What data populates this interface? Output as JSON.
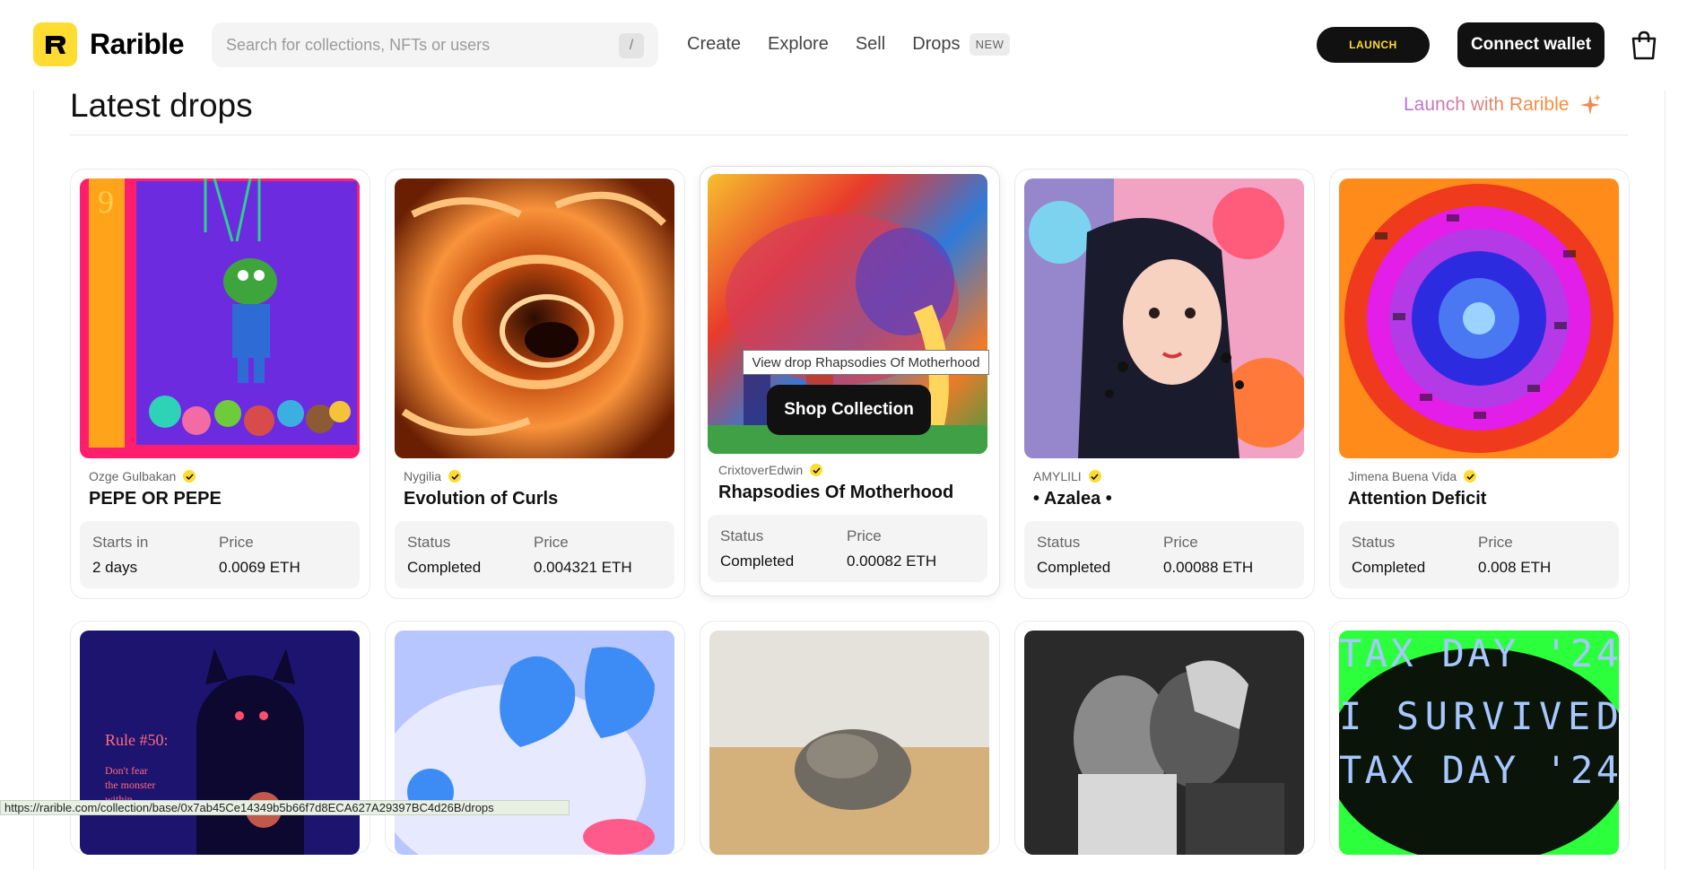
{
  "header": {
    "logo_text": "Rarible",
    "search_placeholder": "Search for collections, NFTs or users",
    "search_shortcut": "/",
    "nav": [
      "Create",
      "Explore",
      "Sell",
      "Drops"
    ],
    "drops_badge": "NEW",
    "launch_label": "LAUNCH",
    "connect_label": "Connect wallet"
  },
  "section": {
    "title": "Latest drops",
    "launch_with_prefix": "Launch with",
    "launch_with_brand": "Rarible"
  },
  "cards": [
    {
      "creator": "Ozge Gulbakan",
      "title": "PEPE OR PEPE",
      "stat1_label": "Starts in",
      "stat1_value": "2 days",
      "price_label": "Price",
      "price": "0.0069 ETH"
    },
    {
      "creator": "Nygilia",
      "title": "Evolution of Curls",
      "stat1_label": "Status",
      "stat1_value": "Completed",
      "price_label": "Price",
      "price": "0.004321 ETH"
    },
    {
      "creator": "CrixtoverEdwin",
      "title": "Rhapsodies Of Motherhood",
      "stat1_label": "Status",
      "stat1_value": "Completed",
      "price_label": "Price",
      "price": "0.00082 ETH"
    },
    {
      "creator": "AMYLILI",
      "title": "• Azalea •",
      "stat1_label": "Status",
      "stat1_value": "Completed",
      "price_label": "Price",
      "price": "0.00088 ETH"
    },
    {
      "creator": "Jimena Buena Vida",
      "title": "Attention Deficit",
      "stat1_label": "Status",
      "stat1_value": "Completed",
      "price_label": "Price",
      "price": "0.008 ETH"
    }
  ],
  "row2": {
    "card1_text_a": "Rule #50:",
    "card1_text_b": "Don't fear",
    "card1_text_c": "the monster",
    "card1_text_d": "within",
    "card5_line1": "TAX DAY '24",
    "card5_line2": "I SURVIVED",
    "card5_line3": "TAX DAY '24"
  },
  "tooltip": "View drop Rhapsodies Of Motherhood",
  "shop_button": "Shop Collection",
  "status_url": "https://rarible.com/collection/base/0x7ab45Ce14349b5b66f7d8ECA627A29397BC4d26B/drops",
  "colors": {
    "brand_yellow": "#fedc31",
    "dark": "#111111"
  }
}
